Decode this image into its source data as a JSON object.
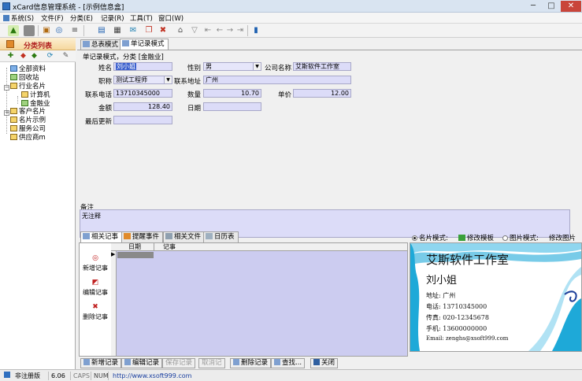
{
  "window": {
    "title": "xCard信息管理系统 - [示例信息盒]",
    "controls": [
      "─",
      "□",
      "✕"
    ]
  },
  "menu": [
    "系统(S)",
    "文件(F)",
    "分类(E)",
    "记录(R)",
    "工具(T)",
    "窗口(W)"
  ],
  "left_panel": {
    "title": "分类列表",
    "tree": [
      {
        "label": "全部资料"
      },
      {
        "label": "回收站"
      },
      {
        "label": "行业名片"
      },
      {
        "label": "计算机"
      },
      {
        "label": "金融业"
      },
      {
        "label": "客户名片"
      },
      {
        "label": "名片示例"
      },
      {
        "label": "服务公司"
      },
      {
        "label": "供应商m"
      }
    ]
  },
  "tabs": [
    "总表模式",
    "单记录模式"
  ],
  "form": {
    "mode_text": "单记录模式，分类 [金融业]",
    "name_label": "姓名",
    "name_value": "刘小姐",
    "gender_label": "性别",
    "gender_value": "男",
    "company_label": "公司名称",
    "company_value": "艾斯软件工作室",
    "title_label": "职称",
    "title_value": "测试工程师",
    "address_label": "联系地址",
    "address_value": "广州",
    "phone_label": "联系电话",
    "phone_value": "13710345000",
    "qty_label": "数量",
    "qty_value": "10.70",
    "price_label": "单价",
    "price_value": "12.00",
    "amount_label": "金额",
    "amount_value": "128.40",
    "date_label": "日期",
    "date_value": "",
    "updated_label": "最后更新",
    "updated_value": "",
    "notes_label": "备注",
    "notes_value": "无注释"
  },
  "bottom_tabs": [
    "相关记事",
    "提醒事件",
    "相关文件",
    "日历表"
  ],
  "side_actions": [
    "新增记事",
    "编辑记事",
    "删除记事"
  ],
  "grid": {
    "columns": [
      "日期",
      "记事"
    ]
  },
  "card_modes": {
    "mode1": "名片模式:",
    "edit_template": "修改模板",
    "mode2": "图片模式:",
    "edit_image": "修改图片"
  },
  "card": {
    "company": "艾斯软件工作室",
    "name": "刘小姐",
    "address": "地址: 广州",
    "phone": "电话: 13710345000",
    "fax": "传真: 020-12345678",
    "mobile": "手机: 13600000000",
    "email": "Email: zenghs@xsoft999.com",
    "accent_color": "#1ea9d8"
  },
  "bottom_buttons": [
    {
      "label": "新增记录",
      "enabled": true
    },
    {
      "label": "编辑记录",
      "enabled": true
    },
    {
      "label": "保存记录",
      "enabled": false
    },
    {
      "label": "取消记",
      "enabled": false
    },
    {
      "label": "删除记录",
      "enabled": true
    },
    {
      "label": "查找...",
      "enabled": true
    },
    {
      "label": "关闭",
      "enabled": true
    }
  ],
  "status": {
    "reg": "非注册版",
    "version": "6.06",
    "caps": "CAPS",
    "num": "NUM",
    "url": "http://www.xsoft999.com"
  }
}
